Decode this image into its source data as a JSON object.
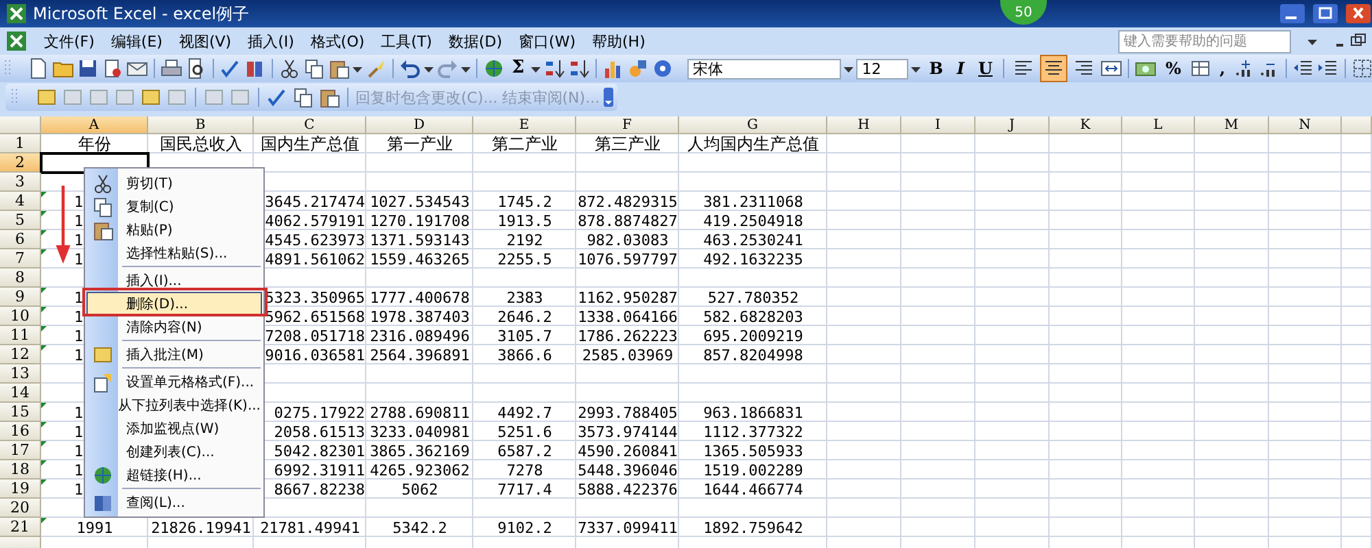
{
  "window": {
    "title": "Microsoft Excel - excel例子"
  },
  "floating_badge": {
    "text": "50"
  },
  "menu_bar": {
    "items": [
      "文件(F)",
      "编辑(E)",
      "视图(V)",
      "插入(I)",
      "格式(O)",
      "工具(T)",
      "数据(D)",
      "窗口(W)",
      "帮助(H)"
    ],
    "help_search": {
      "placeholder": "键入需要帮助的问题"
    }
  },
  "standard_toolbar": {
    "autosum": "Σ"
  },
  "formatting_toolbar": {
    "font": "宋体",
    "size": "12",
    "style_buttons": [
      "B",
      "I",
      "U"
    ],
    "alignment": [
      {
        "selected": false
      },
      {
        "selected": true
      },
      {
        "selected": false
      }
    ],
    "percent": "%",
    "comma": ","
  },
  "reviewing_toolbar": {
    "items": [
      {
        "label": "回复时包含更改(C)...",
        "disabled": true
      },
      {
        "label": "结束审阅(N)...",
        "disabled": true
      }
    ]
  },
  "sheet": {
    "columns": [
      {
        "label": "A",
        "selected": true
      },
      {
        "label": "B",
        "selected": false
      },
      {
        "label": "C",
        "selected": false
      },
      {
        "label": "D",
        "selected": false
      },
      {
        "label": "E",
        "selected": false
      },
      {
        "label": "F",
        "selected": false
      },
      {
        "label": "G",
        "selected": false
      },
      {
        "label": "H",
        "selected": false
      },
      {
        "label": "I",
        "selected": false
      },
      {
        "label": "J",
        "selected": false
      },
      {
        "label": "K",
        "selected": false
      },
      {
        "label": "L",
        "selected": false
      },
      {
        "label": "M",
        "selected": false
      },
      {
        "label": "N",
        "selected": false
      }
    ],
    "rows": [
      {
        "number": "1",
        "selected": false,
        "cells": {
          "A": "年份",
          "B": "国民总收入",
          "C": "国内生产总值",
          "D": "第一产业",
          "E": "第二产业",
          "F": "第三产业",
          "G": "人均国内生产总值"
        }
      },
      {
        "number": "2",
        "selected": true,
        "cells": {}
      },
      {
        "number": "3",
        "selected": false,
        "cells": {}
      },
      {
        "number": "4",
        "selected": false,
        "flag": true,
        "cells": {
          "A": {
            "text": "1",
            "right_covered": true
          },
          "C": {
            "text": "3645.217474",
            "left_covered": true
          },
          "D": "1027.534543",
          "E": "1745.2",
          "F": "872.4829315",
          "G": "381.2311068"
        }
      },
      {
        "number": "5",
        "selected": false,
        "flag": true,
        "cells": {
          "A": {
            "text": "1",
            "right_covered": true
          },
          "C": {
            "text": "4062.579191",
            "left_covered": true
          },
          "D": "1270.191708",
          "E": "1913.5",
          "F": "878.8874827",
          "G": "419.2504918"
        }
      },
      {
        "number": "6",
        "selected": false,
        "flag": true,
        "cells": {
          "A": {
            "text": "1",
            "right_covered": true
          },
          "C": {
            "text": "4545.623973",
            "left_covered": true
          },
          "D": "1371.593143",
          "E": "2192",
          "F": "982.03083",
          "G": "463.2530241"
        }
      },
      {
        "number": "7",
        "selected": false,
        "flag": true,
        "cells": {
          "A": {
            "text": "1",
            "right_covered": true
          },
          "C": {
            "text": "4891.561062",
            "left_covered": true
          },
          "D": "1559.463265",
          "E": "2255.5",
          "F": "1076.597797",
          "G": "492.1632235"
        }
      },
      {
        "number": "8",
        "selected": false,
        "cells": {}
      },
      {
        "number": "9",
        "selected": false,
        "flag": true,
        "cells": {
          "A": {
            "text": "1",
            "right_covered": true
          },
          "C": {
            "text": "5323.350965",
            "left_covered": true
          },
          "D": "1777.400678",
          "E": "2383",
          "F": "1162.950287",
          "G": "527.780352"
        }
      },
      {
        "number": "10",
        "selected": false,
        "flag": true,
        "cells": {
          "A": {
            "text": "1",
            "right_covered": true
          },
          "C": {
            "text": "5962.651568",
            "left_covered": true
          },
          "D": "1978.387403",
          "E": "2646.2",
          "F": "1338.064166",
          "G": "582.6828203"
        }
      },
      {
        "number": "11",
        "selected": false,
        "flag": true,
        "cells": {
          "A": {
            "text": "1",
            "right_covered": true
          },
          "C": {
            "text": "7208.051718",
            "left_covered": true
          },
          "D": "2316.089496",
          "E": "3105.7",
          "F": "1786.262223",
          "G": "695.2009219"
        }
      },
      {
        "number": "12",
        "selected": false,
        "flag": true,
        "cells": {
          "A": {
            "text": "1",
            "right_covered": true
          },
          "C": {
            "text": "9016.036581",
            "left_covered": true
          },
          "D": "2564.396891",
          "E": "3866.6",
          "F": "2585.03969",
          "G": "857.8204998"
        }
      },
      {
        "number": "13",
        "selected": false,
        "cells": {}
      },
      {
        "number": "14",
        "selected": false,
        "cells": {}
      },
      {
        "number": "15",
        "selected": false,
        "flag": true,
        "cells": {
          "A": {
            "text": "1",
            "right_covered": true
          },
          "C": {
            "text": "0275.17922",
            "left_covered": true
          },
          "D": "2788.690811",
          "E": "4492.7",
          "F": "2993.788405",
          "G": "963.1866831"
        }
      },
      {
        "number": "16",
        "selected": false,
        "flag": true,
        "cells": {
          "A": {
            "text": "1",
            "right_covered": true
          },
          "C": {
            "text": "2058.61513",
            "left_covered": true
          },
          "D": "3233.040981",
          "E": "5251.6",
          "F": "3573.974144",
          "G": "1112.377322"
        }
      },
      {
        "number": "17",
        "selected": false,
        "flag": true,
        "cells": {
          "A": {
            "text": "1",
            "right_covered": true
          },
          "C": {
            "text": "5042.82301",
            "left_covered": true
          },
          "D": "3865.362169",
          "E": "6587.2",
          "F": "4590.260841",
          "G": "1365.505933"
        }
      },
      {
        "number": "18",
        "selected": false,
        "flag": true,
        "cells": {
          "A": {
            "text": "1",
            "right_covered": true
          },
          "C": {
            "text": "6992.31911",
            "left_covered": true
          },
          "D": "4265.923062",
          "E": "7278",
          "F": "5448.396046",
          "G": "1519.002289"
        }
      },
      {
        "number": "19",
        "selected": false,
        "flag": true,
        "cells": {
          "A": {
            "text": "1",
            "right_covered": true
          },
          "C": {
            "text": "8667.82238",
            "left_covered": true
          },
          "D": "5062",
          "E": "7717.4",
          "F": "5888.422376",
          "G": "1644.466774"
        }
      },
      {
        "number": "20",
        "selected": false,
        "cells": {}
      },
      {
        "number": "21",
        "selected": false,
        "flag": true,
        "cells": {
          "A": "1991",
          "B": "21826.19941",
          "C": "21781.49941",
          "D": "5342.2",
          "E": "9102.2",
          "F": "7337.099411",
          "G": "1892.759642"
        }
      }
    ]
  },
  "context_menu": {
    "items": [
      {
        "label": "剪切(T)",
        "selected": false,
        "separator_before": false
      },
      {
        "label": "复制(C)",
        "selected": false,
        "separator_before": false
      },
      {
        "label": "粘贴(P)",
        "selected": false,
        "separator_before": false
      },
      {
        "label": "选择性粘贴(S)...",
        "selected": false,
        "separator_before": false
      },
      {
        "label": "插入(I)...",
        "selected": false,
        "separator_before": true
      },
      {
        "label": "删除(D)...",
        "selected": true,
        "separator_before": false
      },
      {
        "label": "清除内容(N)",
        "selected": false,
        "separator_before": false
      },
      {
        "label": "插入批注(M)",
        "selected": false,
        "separator_before": true
      },
      {
        "label": "设置单元格格式(F)...",
        "selected": false,
        "separator_before": true
      },
      {
        "label": "从下拉列表中选择(K)...",
        "selected": false,
        "separator_before": false
      },
      {
        "label": "添加监视点(W)",
        "selected": false,
        "separator_before": false
      },
      {
        "label": "创建列表(C)...",
        "selected": false,
        "separator_before": false
      },
      {
        "label": "超链接(H)...",
        "selected": false,
        "separator_before": false
      },
      {
        "label": "查阅(L)...",
        "selected": false,
        "separator_before": true
      }
    ]
  }
}
